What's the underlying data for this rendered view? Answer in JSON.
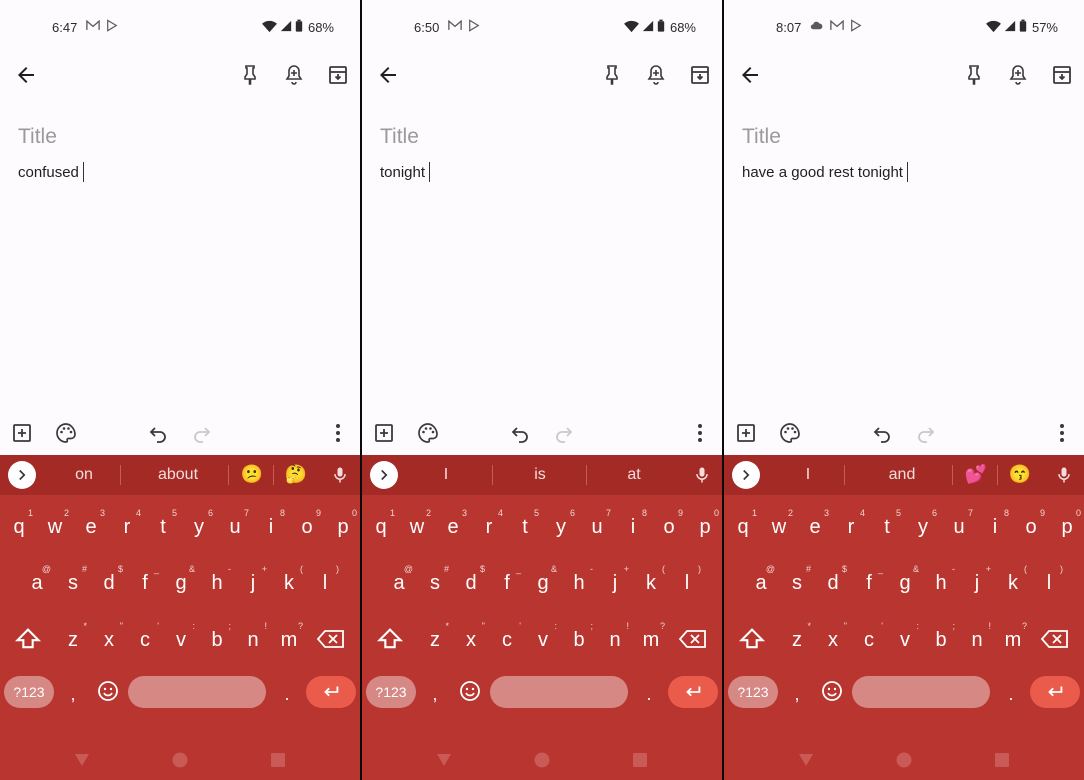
{
  "colors": {
    "keyboard_bg": "#b83530",
    "suggestion_bar_bg": "#a42a25",
    "enter_key": "#ea5b4b",
    "pill_key": "#d68885",
    "note_bg": "#fdfbfe"
  },
  "keyboard": {
    "row1": [
      {
        "key": "q",
        "hint": "1"
      },
      {
        "key": "w",
        "hint": "2"
      },
      {
        "key": "e",
        "hint": "3"
      },
      {
        "key": "r",
        "hint": "4"
      },
      {
        "key": "t",
        "hint": "5"
      },
      {
        "key": "y",
        "hint": "6"
      },
      {
        "key": "u",
        "hint": "7"
      },
      {
        "key": "i",
        "hint": "8"
      },
      {
        "key": "o",
        "hint": "9"
      },
      {
        "key": "p",
        "hint": "0"
      }
    ],
    "row2": [
      {
        "key": "a",
        "hint": "@"
      },
      {
        "key": "s",
        "hint": "#"
      },
      {
        "key": "d",
        "hint": "$"
      },
      {
        "key": "f",
        "hint": "_"
      },
      {
        "key": "g",
        "hint": "&"
      },
      {
        "key": "h",
        "hint": "-"
      },
      {
        "key": "j",
        "hint": "+"
      },
      {
        "key": "k",
        "hint": "("
      },
      {
        "key": "l",
        "hint": ")"
      }
    ],
    "row3": [
      {
        "key": "z",
        "hint": "*"
      },
      {
        "key": "x",
        "hint": "\""
      },
      {
        "key": "c",
        "hint": "'"
      },
      {
        "key": "v",
        "hint": ":"
      },
      {
        "key": "b",
        "hint": ";"
      },
      {
        "key": "n",
        "hint": "!"
      },
      {
        "key": "m",
        "hint": "?"
      }
    ],
    "num_label": "?123",
    "comma": ",",
    "period": "."
  },
  "panels": [
    {
      "status": {
        "time": "6:47",
        "battery": "68%",
        "icons": [
          "gmail-icon",
          "play-store-icon"
        ]
      },
      "note": {
        "title_placeholder": "Title",
        "body": "confused"
      },
      "suggestions": {
        "words": [
          "on",
          "about"
        ],
        "emojis": [
          "😕",
          "🤔"
        ]
      }
    },
    {
      "status": {
        "time": "6:50",
        "battery": "68%",
        "icons": [
          "gmail-icon",
          "play-store-icon"
        ]
      },
      "note": {
        "title_placeholder": "Title",
        "body": "tonight"
      },
      "suggestions": {
        "words": [
          "I",
          "is",
          "at"
        ],
        "emojis": []
      }
    },
    {
      "status": {
        "time": "8:07",
        "battery": "57%",
        "icons": [
          "cloud-icon",
          "gmail-icon",
          "play-store-icon"
        ]
      },
      "note": {
        "title_placeholder": "Title",
        "body": "have a good rest tonight"
      },
      "suggestions": {
        "words": [
          "I",
          "and"
        ],
        "emojis": [
          "💕",
          "😙"
        ]
      }
    }
  ]
}
